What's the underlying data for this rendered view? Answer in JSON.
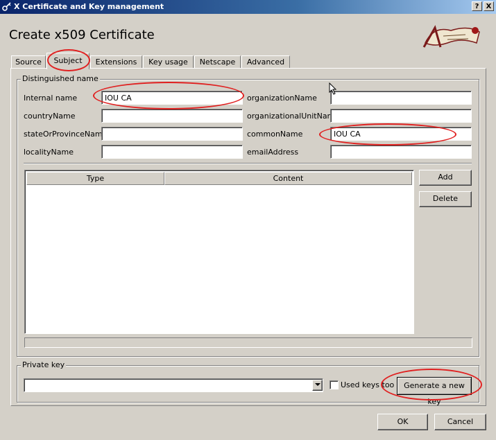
{
  "window": {
    "title": "X Certificate and Key management",
    "help_button": "?",
    "close_button": "X"
  },
  "page": {
    "title": "Create x509 Certificate"
  },
  "tabs": [
    {
      "label": "Source"
    },
    {
      "label": "Subject"
    },
    {
      "label": "Extensions"
    },
    {
      "label": "Key usage"
    },
    {
      "label": "Netscape"
    },
    {
      "label": "Advanced"
    }
  ],
  "distinguished_name": {
    "group_label": "Distinguished name",
    "internal_name": {
      "label": "Internal name",
      "value": "IOU CA"
    },
    "country_name": {
      "label": "countryName",
      "value": ""
    },
    "state_or_province_name": {
      "label": "stateOrProvinceName",
      "value": ""
    },
    "locality_name": {
      "label": "localityName",
      "value": ""
    },
    "organization_name": {
      "label": "organizationName",
      "value": ""
    },
    "organizational_unit_name": {
      "label": "organizationalUnitName",
      "value": ""
    },
    "common_name": {
      "label": "commonName",
      "value": "IOU CA"
    },
    "email_address": {
      "label": "emailAddress",
      "value": ""
    }
  },
  "table": {
    "columns": [
      "Type",
      "Content"
    ],
    "rows": []
  },
  "table_buttons": {
    "add": "Add",
    "delete": "Delete"
  },
  "private_key": {
    "group_label": "Private key",
    "selected": "",
    "used_keys_too": {
      "label": "Used keys too",
      "checked": false
    },
    "generate_button": "Generate a new key"
  },
  "dialog_buttons": {
    "ok": "OK",
    "cancel": "Cancel"
  },
  "annotation_color": "#e02020"
}
